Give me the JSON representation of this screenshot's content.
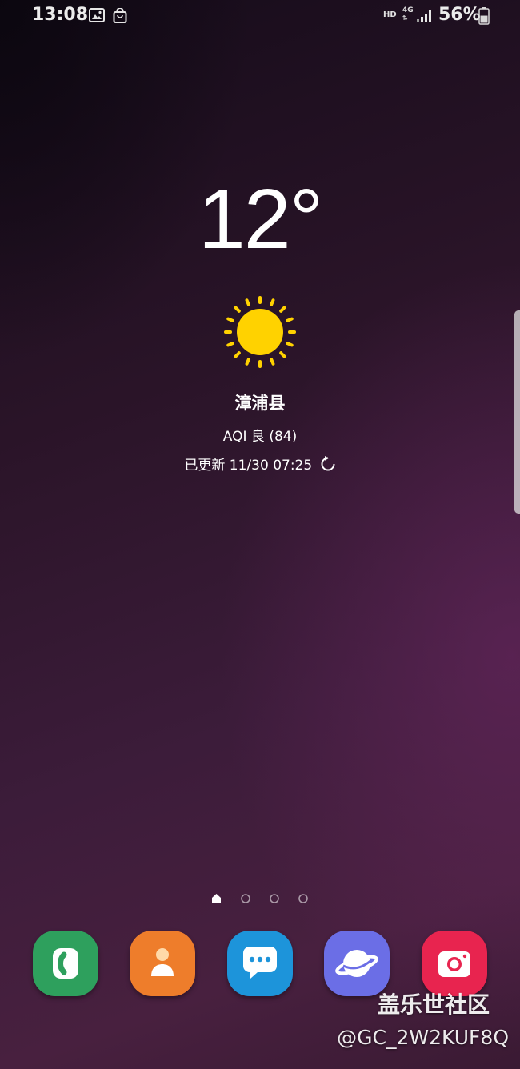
{
  "status_bar": {
    "time": "13:08",
    "icons": [
      "gallery-icon",
      "shopping-bag-icon"
    ],
    "hd": "HD",
    "network": "4G",
    "battery_percent": "56%",
    "battery_level": 0.56
  },
  "weather": {
    "temperature": "12°",
    "condition_icon": "sun-icon",
    "city": "漳浦县",
    "aqi": "AQI 良 (84)",
    "updated": "已更新 11/30 07:25"
  },
  "home": {
    "page_count": 4,
    "current_page": 1
  },
  "dock": {
    "apps": [
      {
        "name": "phone-app",
        "icon": "phone-icon",
        "color": "#2ea05d"
      },
      {
        "name": "contacts-app",
        "icon": "contacts-icon",
        "color": "#ee7d2b"
      },
      {
        "name": "messages-app",
        "icon": "messages-icon",
        "color": "#1d94da"
      },
      {
        "name": "internet-app",
        "icon": "internet-planet-icon",
        "color": "#6b6ee6"
      },
      {
        "name": "camera-app",
        "icon": "camera-icon",
        "color": "#e8244f"
      }
    ]
  },
  "watermark": {
    "title": "盖乐世社区",
    "user": "@GC_2W2KUF8Q"
  }
}
